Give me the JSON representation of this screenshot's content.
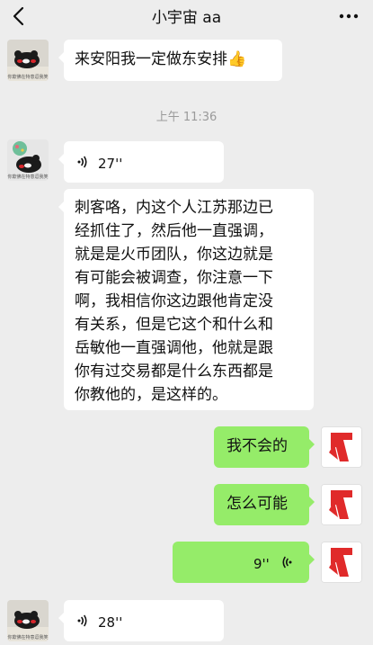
{
  "header": {
    "title": "小宇宙 aa",
    "back_icon": "chevron-left-icon",
    "more_icon": "ellipsis-icon"
  },
  "left_avatar_caption": "你欺佛在特意逗我笑",
  "messages": [
    {
      "from": "other",
      "kind": "text",
      "text": "来安阳我一定做东安排👍"
    },
    {
      "kind": "time",
      "text": "上午 11:36"
    },
    {
      "from": "other",
      "kind": "voice",
      "duration": "27''"
    },
    {
      "from": "other",
      "kind": "text",
      "lines": [
        "刺客咯，内这个人江苏那边已",
        "经抓住了，然后他一直强调，",
        "就是是火币团队，你这边就是",
        "有可能会被调查，你注意一下",
        "啊，我相信你这边跟他肯定没",
        "有关系，但是它这个和什么和",
        "岳敏他一直强调他，他就是跟",
        "你有过交易都是什么东西都是",
        "你教他的，是这样的。"
      ]
    },
    {
      "from": "me",
      "kind": "text",
      "text": "我不会的"
    },
    {
      "from": "me",
      "kind": "text",
      "text": "怎么可能"
    },
    {
      "from": "me",
      "kind": "voice",
      "duration": "9''"
    },
    {
      "from": "other",
      "kind": "voice",
      "duration": "28''"
    }
  ],
  "colors": {
    "background": "#ededed",
    "my_bubble": "#95ec69",
    "their_bubble": "#ffffff",
    "my_avatar": "#e02a2a"
  }
}
